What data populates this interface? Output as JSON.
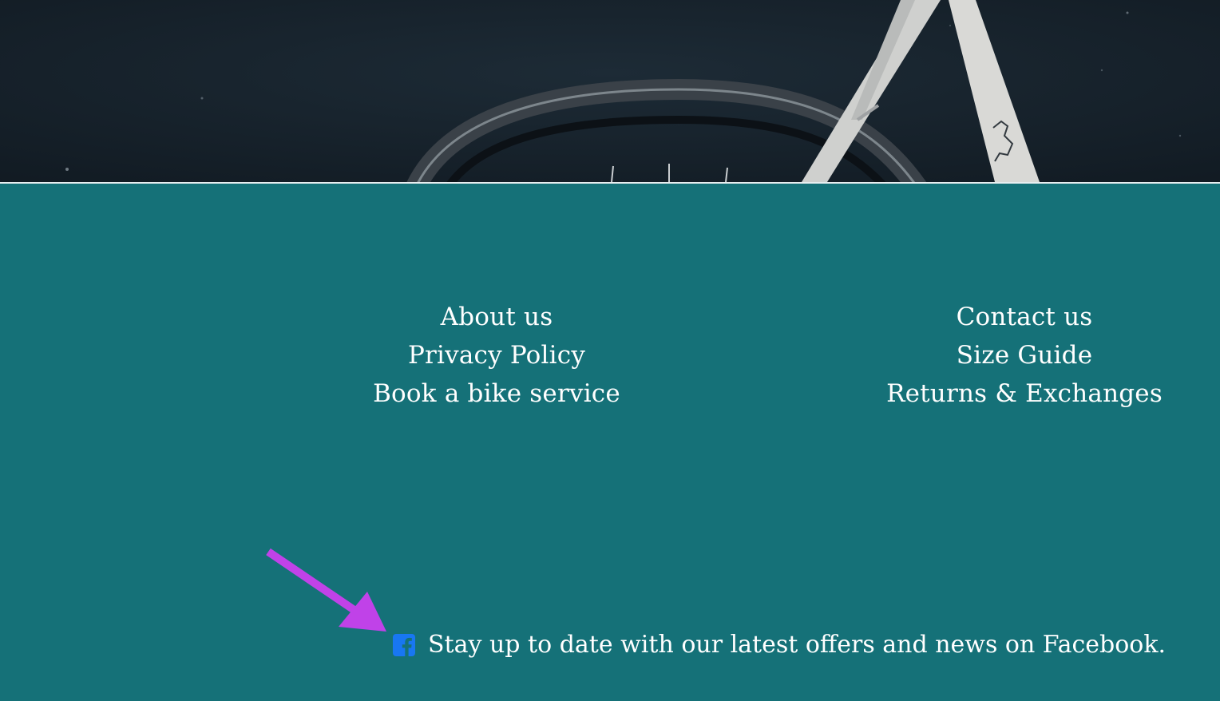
{
  "footer": {
    "left_links": [
      "About us",
      "Privacy Policy",
      "Book a bike service"
    ],
    "right_links": [
      "Contact us",
      "Size Guide",
      "Returns & Exchanges"
    ],
    "facebook": {
      "icon": "facebook-icon",
      "text": "Stay up to date with our latest offers and news on Facebook."
    }
  },
  "colors": {
    "footer_background": "#157178",
    "hero_background": "#17222c",
    "link_text": "#ffffff",
    "facebook_blue": "#1877f2",
    "annotation_arrow": "#c042e8"
  }
}
